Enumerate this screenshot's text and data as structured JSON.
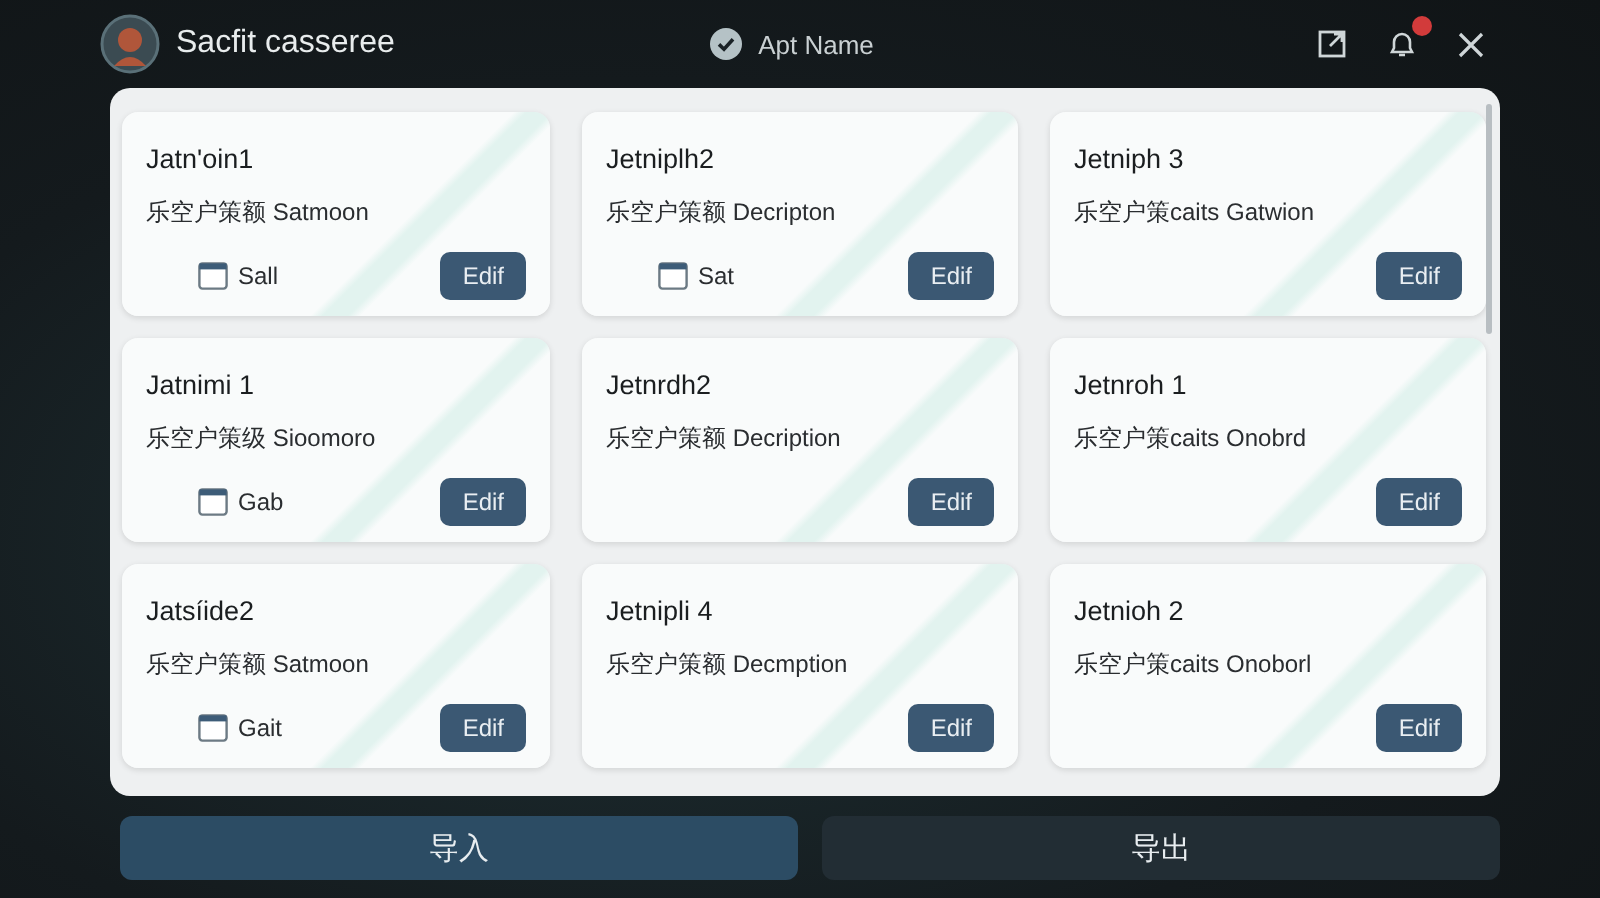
{
  "header": {
    "title": "Sacfit casseree",
    "app_name": "Apt Name",
    "notification_badge": true
  },
  "cards": [
    {
      "title": "Jatn'oin1",
      "description": "乐空户策额 Satmoon",
      "tag": "Sall",
      "button": "Edif"
    },
    {
      "title": "Jetniplh2",
      "description": "乐空户策额 Decripton",
      "tag": "Sat",
      "button": "Edif"
    },
    {
      "title": "Jetniph 3",
      "description": "乐空户策caits Gatwion",
      "button": "Edif"
    },
    {
      "title": "Jatnimi 1",
      "description": "乐空户策级 Sioomoro",
      "tag": "Gab",
      "button": "Edif"
    },
    {
      "title": "Jetnrdh2",
      "description": "乐空户策额 Decription",
      "button": "Edif"
    },
    {
      "title": "Jetnroh 1",
      "description": "乐空户策caits Onobrd",
      "button": "Edif"
    },
    {
      "title": "Jatsíide2",
      "description": "乐空户策额 Satmoon",
      "tag": "Gait",
      "button": "Edif"
    },
    {
      "title": "Jetnipli 4",
      "description": "乐空户策额 Decmption",
      "button": "Edif"
    },
    {
      "title": "Jetnioh 2",
      "description": "乐空户策caits Onoborl",
      "button": "Edif"
    }
  ],
  "actions": [
    {
      "label": "导入",
      "selected": true
    },
    {
      "label": "导出",
      "selected": false
    }
  ]
}
